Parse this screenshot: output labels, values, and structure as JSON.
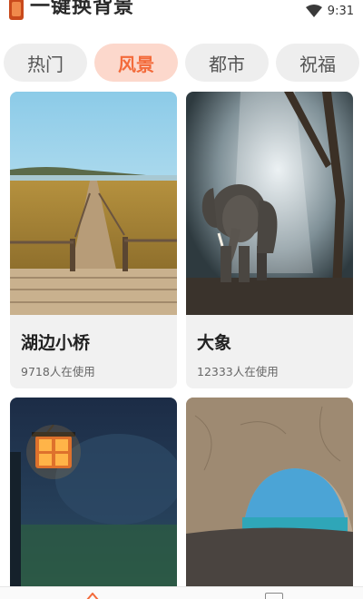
{
  "app": {
    "title": "一键换背景",
    "icon": "app-logo-icon"
  },
  "status_bar": {
    "time": "9:31",
    "wifi_icon": "wifi-icon"
  },
  "tabs": [
    {
      "label": "热门",
      "active": false
    },
    {
      "label": "风景",
      "active": true
    },
    {
      "label": "都市",
      "active": false
    },
    {
      "label": "祝福",
      "active": false
    }
  ],
  "cards": [
    {
      "title": "湖边小桥",
      "usage": "9718人在使用"
    },
    {
      "title": "大象",
      "usage": "12333人在使用"
    },
    {
      "title": "",
      "usage": ""
    },
    {
      "title": "",
      "usage": ""
    }
  ],
  "colors": {
    "accent": "#f36a3a",
    "accent_bg": "#fcd8cc",
    "tab_bg": "#eeeeee",
    "card_bg": "#f1f1f1"
  }
}
